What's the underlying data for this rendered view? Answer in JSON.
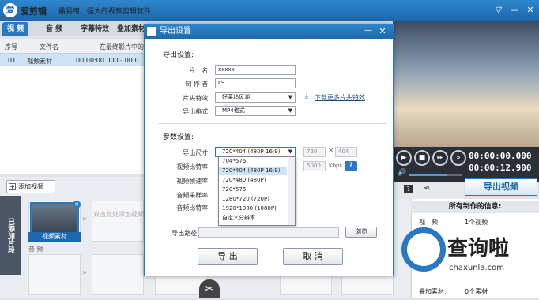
{
  "app": {
    "logo": "爱",
    "name": "爱剪辑",
    "slogan": "最易用、强大的视频剪辑软件",
    "win_buttons": [
      "▽",
      "—",
      "✕"
    ]
  },
  "tabs": [
    "视 频",
    "音 频",
    "字幕特效",
    "叠加素材"
  ],
  "list": {
    "headers": [
      "序号",
      "文件名",
      "在最终影片中的时"
    ],
    "rows": [
      {
        "num": "01",
        "name": "视频素材",
        "time": "00:00:00.000 - 00:0"
      }
    ]
  },
  "bottom": {
    "add_video": "添加视频",
    "side_tab": "已添加片段",
    "thumb_label": "视频素材",
    "drop_hint": "双击此处添加视频",
    "audio_label": "音 频"
  },
  "player": {
    "time_current": "00:00:00.000",
    "time_total": "00:00:12.900"
  },
  "export_button": "导出视频",
  "info": {
    "title": "所有制作的信息:",
    "rows": [
      {
        "label": "视　频:",
        "value": "1个视频"
      },
      {
        "label": "叠加素材:",
        "value": "0个素材"
      }
    ]
  },
  "watermark": {
    "text": "查询啦",
    "url": "chaxunla.com"
  },
  "dialog": {
    "title": "导出设置",
    "export_section": "导出设置:",
    "labels": {
      "name": "片　名:",
      "producer": "制 作 者:",
      "intro": "片头特效:",
      "format": "导出格式:"
    },
    "values": {
      "name": "xxxxx",
      "producer": "LS",
      "intro": "好莱坞风潮",
      "format": "MP4格式"
    },
    "download_link": "下载更多片头特效",
    "params_section": "参数设置:",
    "param_labels": {
      "size": "导出尺寸:",
      "vbitrate": "视频比特率:",
      "framerate": "视频帧速率:",
      "asample": "音频采样率:",
      "abitrate": "音频比特率:"
    },
    "size_value": "720*404 (480P 16:9)",
    "width": "720",
    "times": "×",
    "height": "404",
    "vbitrate_value": "5000",
    "kbps": "Kbps",
    "help": "?",
    "size_options": [
      "704*576",
      "720*404 (480P 16:9)",
      "720*480 (480P)",
      "720*576",
      "1280*720 (720P)",
      "1920*1080 (1080P)",
      "自定义分辨率"
    ],
    "selected_option_index": 1,
    "path_label": "导出路径:",
    "browse": "浏览",
    "export_btn": "导 出",
    "cancel_btn": "取 消"
  }
}
